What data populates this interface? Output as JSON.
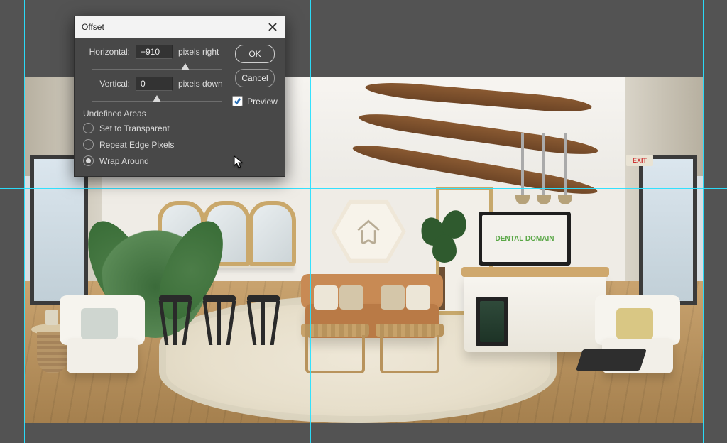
{
  "dialog": {
    "title": "Offset",
    "horizontal_label": "Horizontal:",
    "horizontal_value": "+910",
    "horizontal_unit": "pixels right",
    "vertical_label": "Vertical:",
    "vertical_value": "0",
    "vertical_unit": "pixels down",
    "ok_label": "OK",
    "cancel_label": "Cancel",
    "preview_label": "Preview",
    "preview_checked": true,
    "section_label": "Undefined Areas",
    "radios": {
      "transparent": "Set to Transparent",
      "repeat": "Repeat Edge Pixels",
      "wrap": "Wrap Around",
      "selected": "wrap"
    },
    "slider_h_pos_pct": 72,
    "slider_v_pos_pct": 50
  },
  "guides": {
    "h": [
      265,
      443
    ],
    "v": [
      34,
      437,
      608,
      990
    ]
  },
  "scene": {
    "exit_sign": "EXIT",
    "tv_text": "DENTAL DOMAIN"
  }
}
